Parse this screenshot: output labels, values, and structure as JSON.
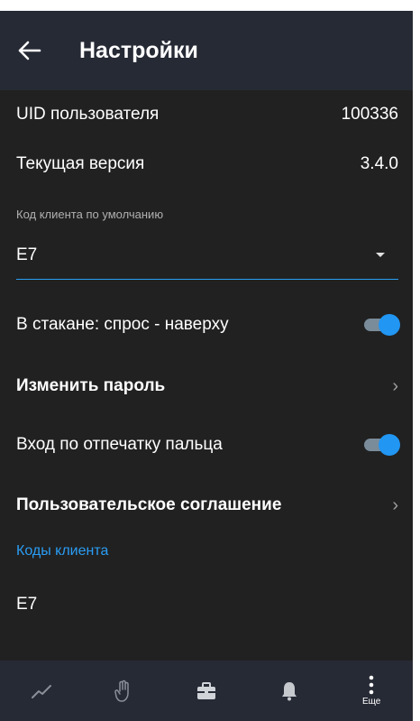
{
  "header": {
    "title": "Настройки",
    "back_icon": "arrow-left-icon"
  },
  "settings": {
    "uid_label": "UID пользователя",
    "uid_value": "100336",
    "version_label": "Текущая версия",
    "version_value": "3.4.0",
    "client_code_caption": "Код клиента по умолчанию",
    "client_code_value": "E7",
    "orderbook_label": "В стакане: спрос - наверху",
    "orderbook_enabled": true,
    "change_password_label": "Изменить пароль",
    "fingerprint_label": "Вход по отпечатку пальца",
    "fingerprint_enabled": true,
    "agreement_label": "Пользовательское соглашение"
  },
  "client_codes": {
    "title": "Коды клиента",
    "items": [
      "E7"
    ]
  },
  "bottom_nav": {
    "items": [
      {
        "icon": "chart-line-icon",
        "label": ""
      },
      {
        "icon": "hand-icon",
        "label": ""
      },
      {
        "icon": "briefcase-icon",
        "label": ""
      },
      {
        "icon": "bell-icon",
        "label": ""
      },
      {
        "icon": "more-vertical-icon",
        "label": "Еще"
      }
    ]
  },
  "colors": {
    "accent": "#2196f3",
    "background": "#212121",
    "appbar": "#262a35"
  }
}
